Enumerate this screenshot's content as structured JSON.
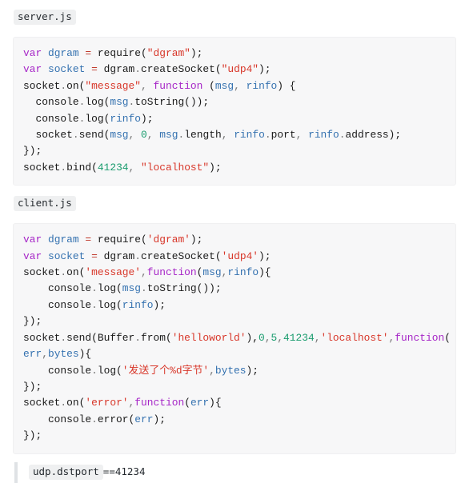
{
  "sections": [
    {
      "label": "server.js",
      "code_lines": [
        [
          {
            "t": "var ",
            "c": "k"
          },
          {
            "t": "dgram",
            "c": "v"
          },
          {
            "t": " ",
            "c": "p"
          },
          {
            "t": "=",
            "c": "o"
          },
          {
            "t": " require(",
            "c": "p"
          },
          {
            "t": "\"dgram\"",
            "c": "s"
          },
          {
            "t": ");",
            "c": "p"
          }
        ],
        [
          {
            "t": "var ",
            "c": "k"
          },
          {
            "t": "socket",
            "c": "v"
          },
          {
            "t": " ",
            "c": "p"
          },
          {
            "t": "=",
            "c": "o"
          },
          {
            "t": " dgram",
            "c": "p"
          },
          {
            "t": ".",
            "c": "d"
          },
          {
            "t": "createSocket(",
            "c": "p"
          },
          {
            "t": "\"udp4\"",
            "c": "s"
          },
          {
            "t": ");",
            "c": "p"
          }
        ],
        [
          {
            "t": "socket",
            "c": "p"
          },
          {
            "t": ".",
            "c": "d"
          },
          {
            "t": "on(",
            "c": "p"
          },
          {
            "t": "\"message\"",
            "c": "s"
          },
          {
            "t": ",",
            "c": "d"
          },
          {
            "t": " ",
            "c": "p"
          },
          {
            "t": "function",
            "c": "k"
          },
          {
            "t": " (",
            "c": "p"
          },
          {
            "t": "msg",
            "c": "v"
          },
          {
            "t": ",",
            "c": "d"
          },
          {
            "t": " ",
            "c": "p"
          },
          {
            "t": "rinfo",
            "c": "v"
          },
          {
            "t": ") {",
            "c": "p"
          }
        ],
        [
          {
            "t": "  console",
            "c": "p"
          },
          {
            "t": ".",
            "c": "d"
          },
          {
            "t": "log(",
            "c": "p"
          },
          {
            "t": "msg",
            "c": "v"
          },
          {
            "t": ".",
            "c": "d"
          },
          {
            "t": "toString());",
            "c": "p"
          }
        ],
        [
          {
            "t": "  console",
            "c": "p"
          },
          {
            "t": ".",
            "c": "d"
          },
          {
            "t": "log(",
            "c": "p"
          },
          {
            "t": "rinfo",
            "c": "v"
          },
          {
            "t": ");",
            "c": "p"
          }
        ],
        [
          {
            "t": "  socket",
            "c": "p"
          },
          {
            "t": ".",
            "c": "d"
          },
          {
            "t": "send(",
            "c": "p"
          },
          {
            "t": "msg",
            "c": "v"
          },
          {
            "t": ",",
            "c": "d"
          },
          {
            "t": " ",
            "c": "p"
          },
          {
            "t": "0",
            "c": "n"
          },
          {
            "t": ",",
            "c": "d"
          },
          {
            "t": " ",
            "c": "p"
          },
          {
            "t": "msg",
            "c": "v"
          },
          {
            "t": ".",
            "c": "d"
          },
          {
            "t": "length",
            "c": "p"
          },
          {
            "t": ",",
            "c": "d"
          },
          {
            "t": " ",
            "c": "p"
          },
          {
            "t": "rinfo",
            "c": "v"
          },
          {
            "t": ".",
            "c": "d"
          },
          {
            "t": "port",
            "c": "p"
          },
          {
            "t": ",",
            "c": "d"
          },
          {
            "t": " ",
            "c": "p"
          },
          {
            "t": "rinfo",
            "c": "v"
          },
          {
            "t": ".",
            "c": "d"
          },
          {
            "t": "address);",
            "c": "p"
          }
        ],
        [
          {
            "t": "});",
            "c": "p"
          }
        ],
        [
          {
            "t": "socket",
            "c": "p"
          },
          {
            "t": ".",
            "c": "d"
          },
          {
            "t": "bind(",
            "c": "p"
          },
          {
            "t": "41234",
            "c": "n"
          },
          {
            "t": ",",
            "c": "d"
          },
          {
            "t": " ",
            "c": "p"
          },
          {
            "t": "\"localhost\"",
            "c": "s"
          },
          {
            "t": ");",
            "c": "p"
          }
        ]
      ]
    },
    {
      "label": "client.js",
      "code_lines": [
        [
          {
            "t": "var ",
            "c": "k"
          },
          {
            "t": "dgram",
            "c": "v"
          },
          {
            "t": " ",
            "c": "p"
          },
          {
            "t": "=",
            "c": "o"
          },
          {
            "t": " require(",
            "c": "p"
          },
          {
            "t": "'dgram'",
            "c": "s"
          },
          {
            "t": ");",
            "c": "p"
          }
        ],
        [
          {
            "t": "var ",
            "c": "k"
          },
          {
            "t": "socket",
            "c": "v"
          },
          {
            "t": " ",
            "c": "p"
          },
          {
            "t": "=",
            "c": "o"
          },
          {
            "t": " dgram",
            "c": "p"
          },
          {
            "t": ".",
            "c": "d"
          },
          {
            "t": "createSocket(",
            "c": "p"
          },
          {
            "t": "'udp4'",
            "c": "s"
          },
          {
            "t": ");",
            "c": "p"
          }
        ],
        [
          {
            "t": "socket",
            "c": "p"
          },
          {
            "t": ".",
            "c": "d"
          },
          {
            "t": "on(",
            "c": "p"
          },
          {
            "t": "'message'",
            "c": "s"
          },
          {
            "t": ",",
            "c": "d"
          },
          {
            "t": "function",
            "c": "k"
          },
          {
            "t": "(",
            "c": "p"
          },
          {
            "t": "msg",
            "c": "v"
          },
          {
            "t": ",",
            "c": "d"
          },
          {
            "t": "rinfo",
            "c": "v"
          },
          {
            "t": "){",
            "c": "p"
          }
        ],
        [
          {
            "t": "    console",
            "c": "p"
          },
          {
            "t": ".",
            "c": "d"
          },
          {
            "t": "log(",
            "c": "p"
          },
          {
            "t": "msg",
            "c": "v"
          },
          {
            "t": ".",
            "c": "d"
          },
          {
            "t": "toString());",
            "c": "p"
          }
        ],
        [
          {
            "t": "    console",
            "c": "p"
          },
          {
            "t": ".",
            "c": "d"
          },
          {
            "t": "log(",
            "c": "p"
          },
          {
            "t": "rinfo",
            "c": "v"
          },
          {
            "t": ");",
            "c": "p"
          }
        ],
        [
          {
            "t": "});",
            "c": "p"
          }
        ],
        [
          {
            "t": "socket",
            "c": "p"
          },
          {
            "t": ".",
            "c": "d"
          },
          {
            "t": "send(Buffer",
            "c": "p"
          },
          {
            "t": ".",
            "c": "d"
          },
          {
            "t": "from(",
            "c": "p"
          },
          {
            "t": "'helloworld'",
            "c": "s"
          },
          {
            "t": "),",
            "c": "p"
          },
          {
            "t": "0",
            "c": "n"
          },
          {
            "t": ",",
            "c": "d"
          },
          {
            "t": "5",
            "c": "n"
          },
          {
            "t": ",",
            "c": "d"
          },
          {
            "t": "41234",
            "c": "n"
          },
          {
            "t": ",",
            "c": "d"
          },
          {
            "t": "'localhost'",
            "c": "s"
          },
          {
            "t": ",",
            "c": "d"
          },
          {
            "t": "function",
            "c": "k"
          },
          {
            "t": "(",
            "c": "p"
          }
        ],
        [
          {
            "t": "err",
            "c": "v"
          },
          {
            "t": ",",
            "c": "d"
          },
          {
            "t": "bytes",
            "c": "v"
          },
          {
            "t": "){",
            "c": "p"
          }
        ],
        [
          {
            "t": "    console",
            "c": "p"
          },
          {
            "t": ".",
            "c": "d"
          },
          {
            "t": "log(",
            "c": "p"
          },
          {
            "t": "'发送了个%d字节'",
            "c": "s"
          },
          {
            "t": ",",
            "c": "d"
          },
          {
            "t": "bytes",
            "c": "v"
          },
          {
            "t": ");",
            "c": "p"
          }
        ],
        [
          {
            "t": "});",
            "c": "p"
          }
        ],
        [
          {
            "t": "socket",
            "c": "p"
          },
          {
            "t": ".",
            "c": "d"
          },
          {
            "t": "on(",
            "c": "p"
          },
          {
            "t": "'error'",
            "c": "s"
          },
          {
            "t": ",",
            "c": "d"
          },
          {
            "t": "function",
            "c": "k"
          },
          {
            "t": "(",
            "c": "p"
          },
          {
            "t": "err",
            "c": "v"
          },
          {
            "t": "){",
            "c": "p"
          }
        ],
        [
          {
            "t": "    console",
            "c": "p"
          },
          {
            "t": ".",
            "c": "d"
          },
          {
            "t": "error(",
            "c": "p"
          },
          {
            "t": "err",
            "c": "v"
          },
          {
            "t": ");",
            "c": "p"
          }
        ],
        [
          {
            "t": "});",
            "c": "p"
          }
        ]
      ]
    }
  ],
  "blockquote": {
    "code": "udp.dstport",
    "text": "==41234"
  },
  "colors": {
    "keyword": "#a626c7",
    "variable": "#3572b0",
    "string": "#d8372a",
    "number": "#1a9c6e",
    "operator": "#c0392b",
    "plain": "#1a1a1a",
    "codeblock_bg": "#f7f7f8",
    "inline_code_bg": "#eff0f1",
    "quote_border": "#dfe2e5"
  }
}
